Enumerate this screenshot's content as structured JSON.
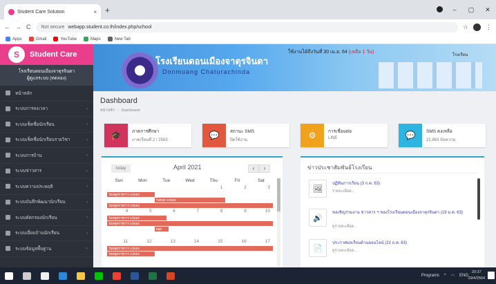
{
  "browser": {
    "tab_title": "Student Care Solution",
    "tab_close": "×",
    "new_tab": "+",
    "window_controls": [
      "–",
      "▢",
      "✕"
    ],
    "nav_back": "←",
    "nav_forward": "→",
    "nav_reload": "C",
    "security_label": "Not secure",
    "url": "webapp.student.co.th/index.php/school",
    "bookmarks": [
      {
        "label": "Apps",
        "color": "#4285f4"
      },
      {
        "label": "Gmail",
        "color": "#ea4335"
      },
      {
        "label": "YouTube",
        "color": "#ff0000"
      },
      {
        "label": "Maps",
        "color": "#34a853"
      },
      {
        "label": "New Tab",
        "color": "#5f6368"
      }
    ]
  },
  "brand": {
    "name": "Student Care",
    "logo_letter": "S",
    "color": "#e83e8c"
  },
  "sidebar": {
    "toggle": "≡",
    "school_line1": "โรงเรียนดอนเมืองจาตุรจินดา",
    "school_line2": "ผู้ดูแลระบบ (ทดลอง)",
    "items": [
      {
        "label": "หน้าหลัก",
        "chevron": ""
      },
      {
        "label": "ระบบการลงเวลา",
        "chevron": "‹"
      },
      {
        "label": "ระบบเช็คชื่อนักเรียน",
        "chevron": "‹"
      },
      {
        "label": "ระบบเช็คชื่อนักเรียนรายวิชา",
        "chevron": "‹"
      },
      {
        "label": "ระบบการบ้าน",
        "chevron": "‹"
      },
      {
        "label": "ระบบข่าวสาร",
        "chevron": "‹"
      },
      {
        "label": "ระบบความประพฤติ",
        "chevron": "‹"
      },
      {
        "label": "ระบบบันทึกพัฒนานักเรียน",
        "chevron": "‹"
      },
      {
        "label": "ระบบคัดกรองนักเรียน",
        "chevron": "‹"
      },
      {
        "label": "ระบบเยี่ยมบ้านนักเรียน",
        "chevron": "‹"
      },
      {
        "label": "ระบบข้อมูลพื้นฐาน",
        "chevron": "‹"
      }
    ]
  },
  "banner": {
    "title_th": "โรงเรียนดอนเมืองจาตุรจินดา",
    "title_en": "Donmuang Chaturachinda",
    "license_text": "ใช้งานได้ถึงวันที่ 30 เม.ย. 64",
    "license_extend": "(เหลือ 1 วัน)",
    "right_text": "โรงเรียน"
  },
  "page": {
    "title": "Dashboard",
    "breadcrumb": [
      "หน้าหลัก",
      "Dashboard"
    ],
    "breadcrumb_sep": "›"
  },
  "cards": [
    {
      "title": "ภาคการศึกษา",
      "value": "ภาคเรียนที่ 2 / 2563",
      "color": "#d0335c",
      "icon": "🎓"
    },
    {
      "title": "สถานะ SMS",
      "value": "ปิดใช้งาน",
      "color": "#e2583e",
      "icon": "💬"
    },
    {
      "title": "การเชื่อมต่อ",
      "value": "LINE",
      "color": "#f1a21c",
      "icon": "⚙"
    },
    {
      "title": "SMS คงเหลือ",
      "value": "22,863 ข้อความ",
      "color": "#2eb4e0",
      "icon": "💬"
    }
  ],
  "calendar": {
    "today_label": "today",
    "month_label": "April 2021",
    "prev": "‹",
    "next": "›",
    "days": [
      "Sun",
      "Mon",
      "Tue",
      "Wed",
      "Thu",
      "Fri",
      "Sat"
    ],
    "weeks": [
      [
        "",
        "",
        "",
        "",
        "1",
        "2",
        "3"
      ],
      [
        "4",
        "5",
        "6",
        "7",
        "8",
        "9",
        "10"
      ],
      [
        "11",
        "12",
        "13",
        "14",
        "15",
        "16",
        "17"
      ]
    ],
    "event_color": "#e26a5a",
    "events": [
      {
        "text": "วันหยุดราชการ 1/2563",
        "week": 0,
        "row": 0,
        "start": 0,
        "span": 2
      },
      {
        "text": "วันหยุด 1/2563",
        "week": 0,
        "row": 1,
        "start": 2,
        "span": 3
      },
      {
        "text": "วันหยุดราชการ 1/2563",
        "week": 0,
        "row": 2,
        "start": 0,
        "span": 7
      },
      {
        "text": "วันหยุดราชการ 1/2563",
        "week": 1,
        "row": 0,
        "start": 0,
        "span": 2.5
      },
      {
        "text": "วันหยุดราชการ 1/2563",
        "week": 1,
        "row": 1,
        "start": 0,
        "span": 7
      },
      {
        "text": "หยุด",
        "week": 1,
        "row": 2,
        "start": 2,
        "span": 0.6
      },
      {
        "text": "วันหยุดราชการ 1/2563",
        "week": 2,
        "row": 0,
        "start": 0,
        "span": 7
      },
      {
        "text": "วันหยุดราชการ 1/2563",
        "week": 2,
        "row": 1,
        "start": 0,
        "span": 2
      }
    ]
  },
  "news": {
    "title": "ข่าวประชาสัมพันธ์โรงเรียน",
    "items": [
      {
        "icon": "🖼",
        "title": "ปฏิทินการเรียน (3 ก.ค. 63)",
        "sub": "รายละเอียด..."
      },
      {
        "icon": "🔊",
        "title": "ขอเชิญร่วมงาน ข่าวสาร ฯ ของโรงเรียนดอนเมืองจาตุรจินดา (19 ม.ค. 63)",
        "sub": "ดูรายละเอียด..."
      },
      {
        "icon": "📄",
        "title": "ประกาศผลเรียนด้านออนไลน์ (22 ธ.ค. 63)",
        "sub": "ดูรายละเอียด..."
      }
    ]
  },
  "taskbar": {
    "apps": [
      {
        "name": "windows",
        "color": "#ffffff"
      },
      {
        "name": "search",
        "color": "#cccccc"
      },
      {
        "name": "store",
        "color": "#f0f0f0"
      },
      {
        "name": "edge",
        "color": "#2b88d8"
      },
      {
        "name": "explorer",
        "color": "#f2c94c"
      },
      {
        "name": "line",
        "color": "#00c300"
      },
      {
        "name": "chrome",
        "color": "#e94235"
      },
      {
        "name": "word",
        "color": "#2b579a"
      },
      {
        "name": "excel",
        "color": "#217346"
      },
      {
        "name": "powerpoint",
        "color": "#d24726"
      }
    ],
    "tray_text": "Programs",
    "lang": "ENG",
    "time": "20:37",
    "date": "29/4/2564"
  }
}
